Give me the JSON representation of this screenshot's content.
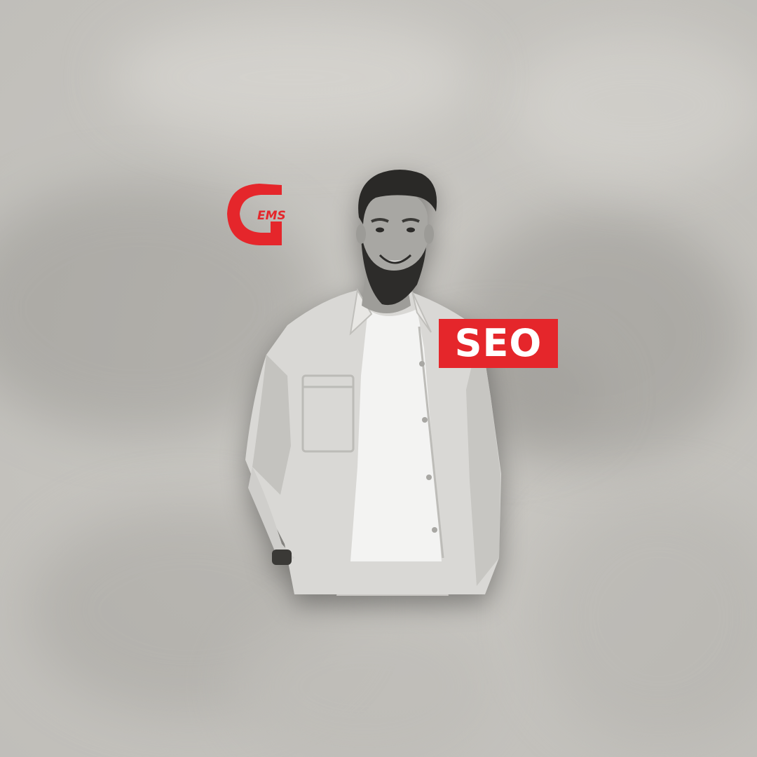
{
  "logo": {
    "letter": "G",
    "tail": "EMS",
    "icon": "gems-logo-icon",
    "color": "#e5262b"
  },
  "badge": {
    "label": "SEO",
    "background": "#e5262b",
    "text_color": "#ffffff"
  },
  "photo": {
    "icon": "person-photo",
    "style": "black-and-white"
  }
}
